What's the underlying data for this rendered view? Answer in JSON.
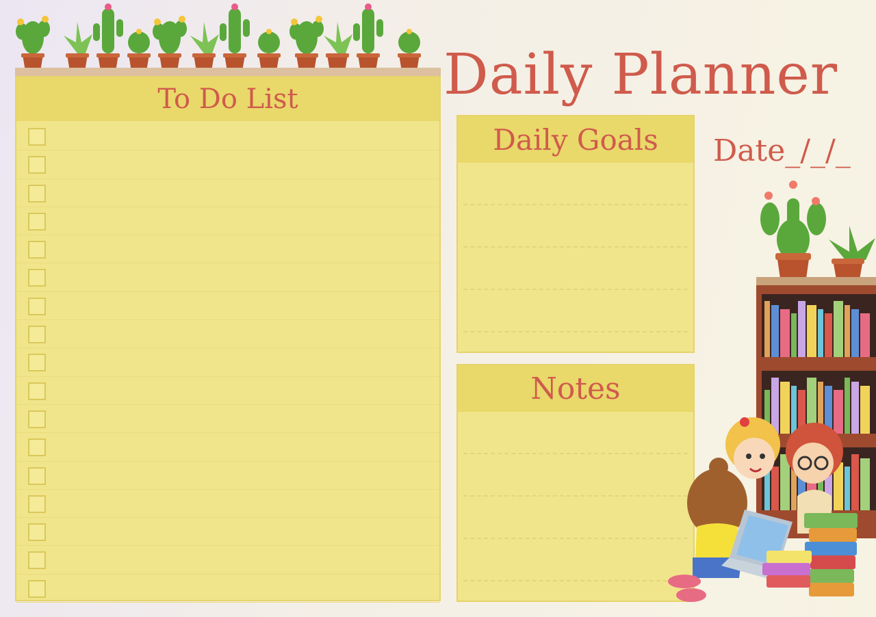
{
  "title": "Daily Planner",
  "date_label": "Date_/_/_",
  "todo": {
    "heading": "To Do List",
    "rows": 17
  },
  "goals": {
    "heading": "Daily Goals",
    "lines": 4
  },
  "notes": {
    "heading": "Notes",
    "lines": 4
  },
  "colors": {
    "title_text": "#cf5b4c",
    "panel_fill": "#f1e58b",
    "panel_header": "#e9d86a",
    "pot": "#b8532e",
    "cactus": "#5aa83c",
    "shelf": "#9e4a2e"
  },
  "decorations": {
    "top_row": "potted-cactus-row",
    "right": "bookshelf-with-plants",
    "bottom_right": "children-reading-books-illustration"
  }
}
